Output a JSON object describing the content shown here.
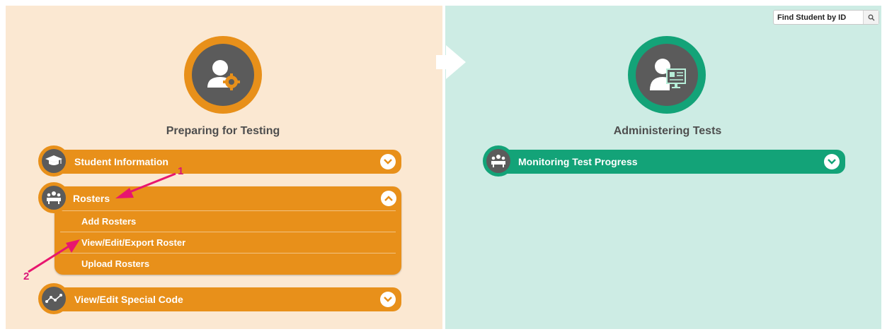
{
  "search": {
    "placeholder": "Find Student by ID",
    "icon": "search-icon"
  },
  "left": {
    "title": "Preparing for Testing",
    "hero_icon": "user-gear-icon",
    "items": [
      {
        "label": "Student Information",
        "icon": "graduation-cap-icon",
        "state": "collapsed"
      },
      {
        "label": "Rosters",
        "icon": "classroom-icon",
        "state": "expanded",
        "subitems": [
          "Add Rosters",
          "View/Edit/Export Roster",
          "Upload Rosters"
        ]
      },
      {
        "label": "View/Edit Special Code",
        "icon": "connected-nodes-icon",
        "state": "collapsed"
      }
    ]
  },
  "right": {
    "title": "Administering Tests",
    "hero_icon": "user-monitor-icon",
    "items": [
      {
        "label": "Monitoring Test Progress",
        "icon": "classroom-icon",
        "state": "collapsed"
      }
    ]
  },
  "annotations": {
    "arrow1": "1",
    "arrow2": "2"
  },
  "colors": {
    "orange": "#e8901a",
    "green": "#13a378",
    "left_bg": "#fbe8d2",
    "right_bg": "#cdece4",
    "annotation": "#e8166f"
  }
}
